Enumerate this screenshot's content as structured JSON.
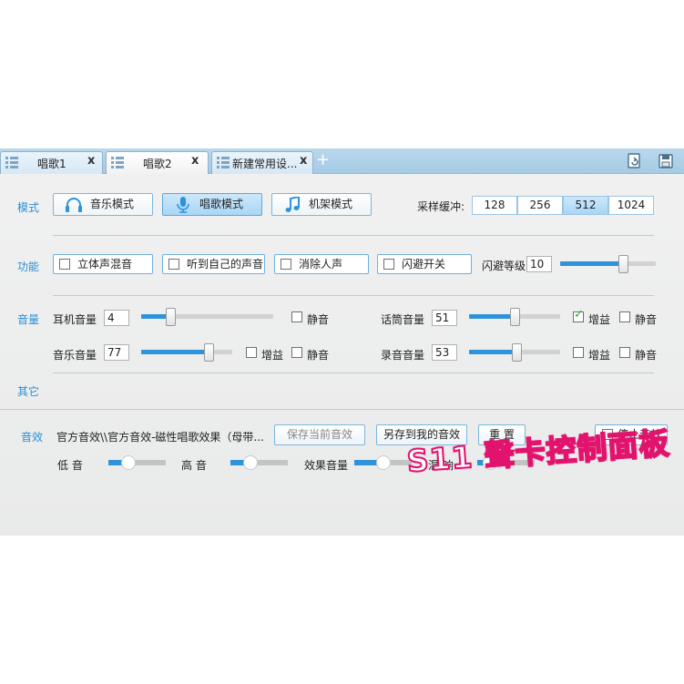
{
  "tabs": [
    {
      "label": "唱歌1",
      "close": "x",
      "active": false
    },
    {
      "label": "唱歌2",
      "close": "x",
      "active": true
    },
    {
      "label": "新建常用设...",
      "close": "x",
      "active": false
    }
  ],
  "tab_add": "+",
  "toolbar_icons": [
    "refresh-icon",
    "save-icon"
  ],
  "sections": {
    "mode": "模式",
    "function": "功能",
    "volume": "音量",
    "other": "其它",
    "effects": "音效"
  },
  "mode_buttons": [
    {
      "label": "音乐模式",
      "icon": "headphones-icon",
      "active": false
    },
    {
      "label": "唱歌模式",
      "icon": "microphone-icon",
      "active": true
    },
    {
      "label": "机架模式",
      "icon": "music-note-icon",
      "active": false
    }
  ],
  "buffer": {
    "label": "采样缓冲:",
    "options": [
      "128",
      "256",
      "512",
      "1024"
    ],
    "selected": "512"
  },
  "functions": [
    {
      "label": "立体声混音",
      "checked": false
    },
    {
      "label": "听到自己的声音",
      "checked": false
    },
    {
      "label": "消除人声",
      "checked": false
    },
    {
      "label": "闪避开关",
      "checked": false
    }
  ],
  "ducking": {
    "label": "闪避等级",
    "value": "10",
    "level": 0.68
  },
  "volume": {
    "headphone": {
      "label": "耳机音量",
      "value": "4",
      "level": 0.2,
      "mute_label": "静音",
      "mute": false
    },
    "music": {
      "label": "音乐音量",
      "value": "77",
      "level": 0.77,
      "gain_label": "增益",
      "gain": false,
      "mute_label": "静音",
      "mute": false
    },
    "mic": {
      "label": "话筒音量",
      "value": "51",
      "level": 0.51,
      "gain_label": "增益",
      "gain": true,
      "mute_label": "静音",
      "mute": false
    },
    "record": {
      "label": "录音音量",
      "value": "53",
      "level": 0.53,
      "gain_label": "增益",
      "gain": false,
      "mute_label": "静音",
      "mute": false
    }
  },
  "effects": {
    "current": "官方音效\\\\官方音效-磁性唱歌效果（母带...",
    "save_current": "保存当前音效",
    "save_as": "另存到我的音效",
    "reset": "重 置",
    "stop_label": "停止音效",
    "stop": false,
    "sliders": [
      {
        "label": "低 音",
        "level": 0.3
      },
      {
        "label": "高 音",
        "level": 0.3
      },
      {
        "label": "效果音量",
        "level": 0.5
      },
      {
        "label": "混 响",
        "level": 0.12
      }
    ]
  },
  "watermark": "S11 聲卡控制面板",
  "colors": {
    "accent": "#2e93db",
    "tabbar": "#a5cbe5",
    "watermark": "#e2136d"
  }
}
